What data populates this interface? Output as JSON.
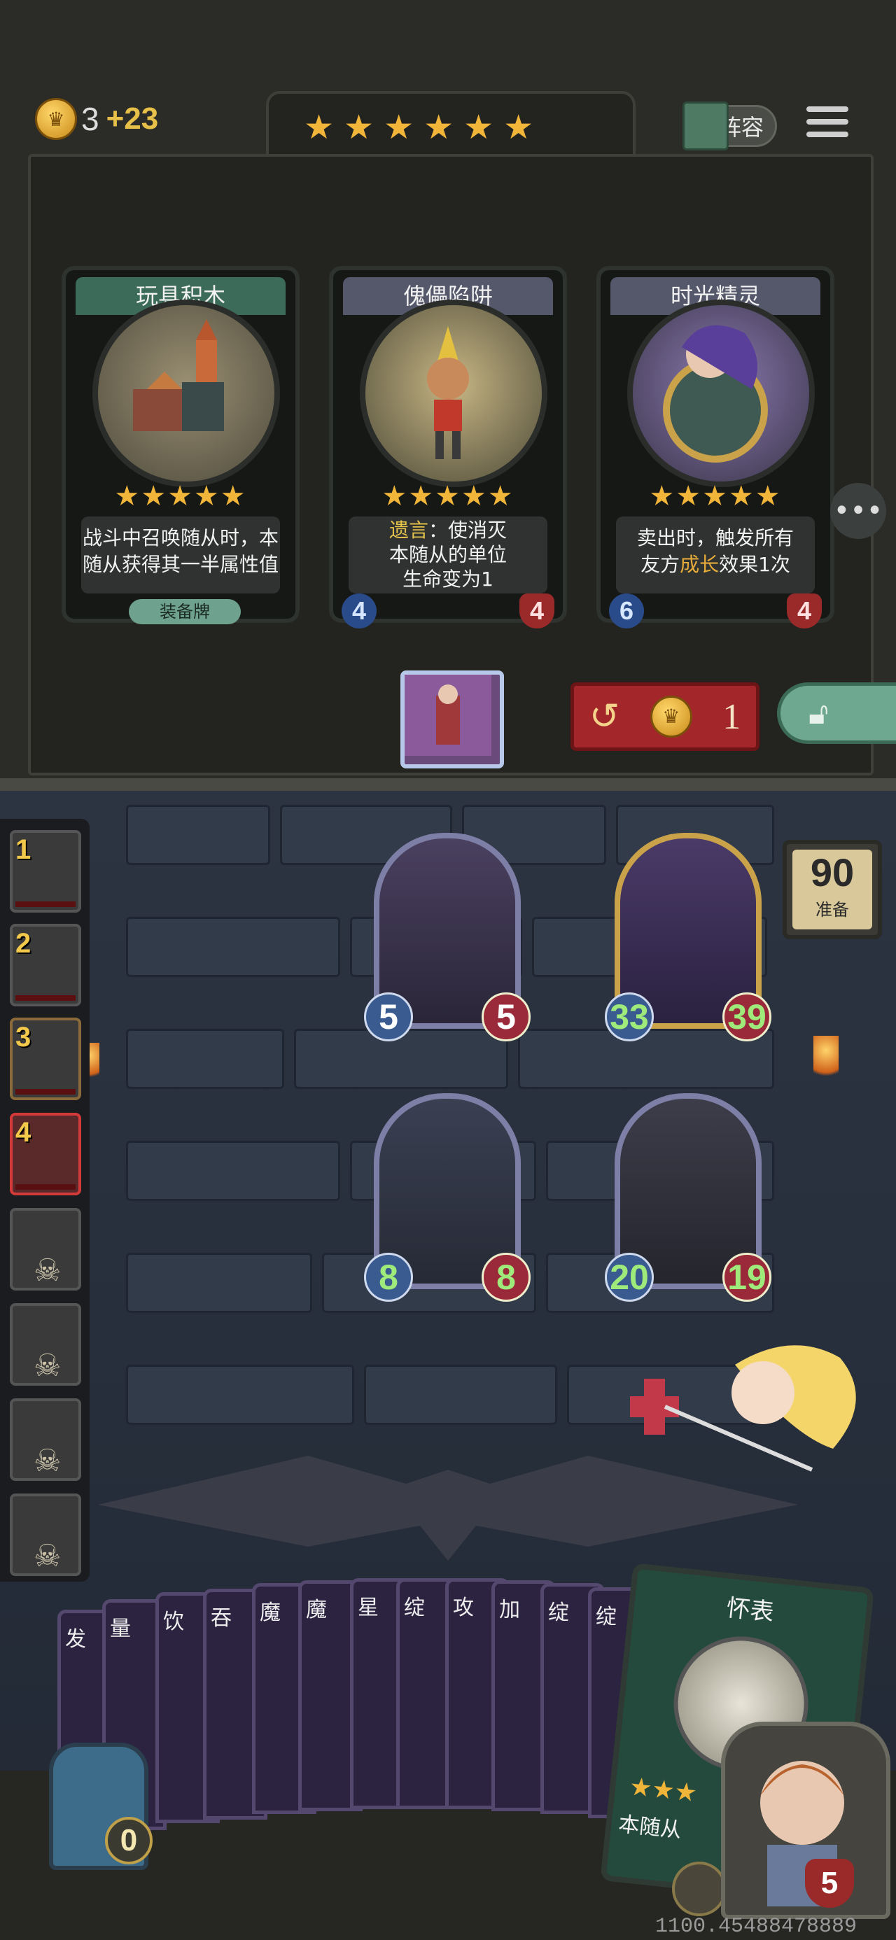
{
  "header": {
    "gold": "3",
    "gold_income": "+23",
    "tavern_stars": "★★★★★★",
    "lineup_label": "阵容"
  },
  "shop_cards": [
    {
      "name": "玩具积木",
      "stars": "★★★★★",
      "desc_line1": "战斗中召唤随从时，本",
      "desc_line2": "随从获得其一半属性值",
      "tag": "装备牌",
      "color": "#3d6b5a"
    },
    {
      "name": "傀儡陷阱",
      "stars": "★★★★★",
      "desc_kw": "遗言",
      "desc_line1_rest": "：使消灭",
      "desc_line2": "本随从的单位",
      "desc_line3": "生命变为1",
      "attack": "4",
      "health": "4",
      "color": "#55586a"
    },
    {
      "name": "时光精灵",
      "stars": "★★★★★",
      "desc_line1": "卖出时，触发所有",
      "desc_line2_pre": "友方",
      "desc_kw": "成长",
      "desc_line2_post": "效果1次",
      "attack": "6",
      "health": "4",
      "color": "#55586a"
    }
  ],
  "refresh": {
    "cost": "1"
  },
  "players": [
    {
      "rank": "1",
      "dead": false
    },
    {
      "rank": "2",
      "dead": false
    },
    {
      "rank": "3",
      "dead": false
    },
    {
      "rank": "4",
      "dead": false,
      "self": true
    },
    {
      "rank": "",
      "dead": true
    },
    {
      "rank": "",
      "dead": true
    },
    {
      "rank": "",
      "dead": true
    },
    {
      "rank": "",
      "dead": true
    }
  ],
  "board": [
    {
      "attack": "5",
      "health": "5",
      "buffed": false,
      "color": "#4a4060"
    },
    {
      "attack": "33",
      "health": "39",
      "buffed": true,
      "color": "#4a3a68"
    },
    {
      "attack": "8",
      "health": "8",
      "buffed": true,
      "color": "#3a4052"
    },
    {
      "attack": "20",
      "health": "19",
      "buffed": true,
      "color": "#3d3d4a"
    }
  ],
  "ready": {
    "count": "90",
    "label": "准备"
  },
  "hand": [
    {
      "title": "发"
    },
    {
      "title": "量"
    },
    {
      "title": "饮"
    },
    {
      "title": "吞"
    },
    {
      "title": "魔"
    },
    {
      "title": "魔"
    },
    {
      "title": "星"
    },
    {
      "title": "绽"
    },
    {
      "title": "攻"
    },
    {
      "title": "加"
    },
    {
      "title": "绽"
    },
    {
      "title": "绽"
    }
  ],
  "pocket_card": {
    "title": "怀表",
    "stars": "★★★",
    "desc": "本随从"
  },
  "hero": {
    "health": "5"
  },
  "deck": {
    "count": "0"
  },
  "debug_coord": "1100.45488478889"
}
